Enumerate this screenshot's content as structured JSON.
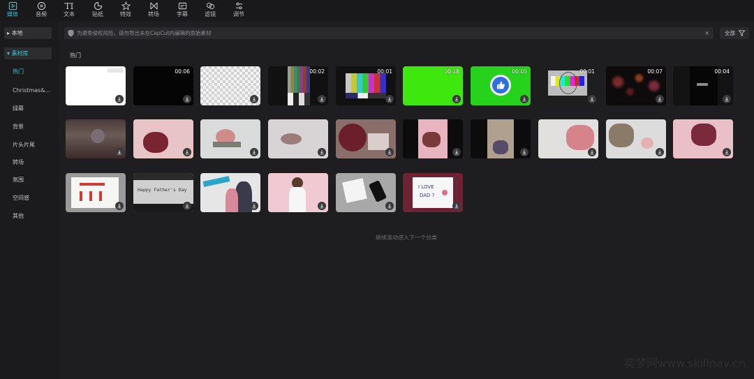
{
  "toolbar": {
    "items": [
      {
        "label": "媒体",
        "icon": "media-icon",
        "active": true
      },
      {
        "label": "音频",
        "icon": "audio-icon"
      },
      {
        "label": "文本",
        "icon": "text-icon"
      },
      {
        "label": "贴纸",
        "icon": "sticker-icon"
      },
      {
        "label": "特效",
        "icon": "effects-icon"
      },
      {
        "label": "转场",
        "icon": "transition-icon"
      },
      {
        "label": "字幕",
        "icon": "subtitle-icon"
      },
      {
        "label": "滤镜",
        "icon": "filter-icon"
      },
      {
        "label": "调节",
        "icon": "adjust-icon"
      }
    ]
  },
  "sidebar": {
    "local_label": "本地",
    "library_label": "素材库",
    "items": [
      "热门",
      "Christmas&...",
      "绿幕",
      "背景",
      "片头片尾",
      "转场",
      "氛围",
      "空间感",
      "其他"
    ]
  },
  "notice": {
    "text": "为避免侵权风险，请勿导出未在CapCut内编辑的原始素材",
    "close": "×"
  },
  "filter": {
    "label": "全部"
  },
  "section_title": "热门",
  "thumbnails": [
    {
      "duration": "",
      "bg": "#ffffff"
    },
    {
      "duration": "00:06",
      "bg": "#050505"
    },
    {
      "duration": "",
      "bg": "checker"
    },
    {
      "duration": "00:02",
      "bg": "bars"
    },
    {
      "duration": "00:01",
      "bg": "bars2"
    },
    {
      "duration": "00:18",
      "bg": "#3ee80f"
    },
    {
      "duration": "00:05",
      "bg": "thumb"
    },
    {
      "duration": "00:01",
      "bg": "testcard"
    },
    {
      "duration": "00:07",
      "bg": "fireworks"
    },
    {
      "duration": "00:04",
      "bg": "dark"
    },
    {
      "duration": "",
      "bg": "flowers-dark"
    },
    {
      "duration": "",
      "bg": "pink-rose"
    },
    {
      "duration": "",
      "bg": "rose-white"
    },
    {
      "duration": "",
      "bg": "flowers-grey"
    },
    {
      "duration": "",
      "bg": "roses-table"
    },
    {
      "duration": "",
      "bg": "pink-vertical"
    },
    {
      "duration": "",
      "bg": "hand-vertical"
    },
    {
      "duration": "",
      "bg": "pink-white-wood"
    },
    {
      "duration": "",
      "bg": "flowers-white"
    },
    {
      "duration": "",
      "bg": "pink-cake"
    },
    {
      "duration": "",
      "bg": "card-flowers"
    },
    {
      "duration": "",
      "bg": "typewriter"
    },
    {
      "duration": "",
      "bg": "dad-kid"
    },
    {
      "duration": "",
      "bg": "boy-pink"
    },
    {
      "duration": "",
      "bg": "note-phone"
    },
    {
      "duration": "",
      "bg": "ilovedad"
    }
  ],
  "thumbnail_text": {
    "happy_fathers_day": "Happy Father's Day",
    "i_love_dad_1": "I LOVE",
    "i_love_dad_2": "DAD ?"
  },
  "loading_text": "继续滚动进入下一个分类",
  "watermark": "奕梦网www.skillnav.cn"
}
